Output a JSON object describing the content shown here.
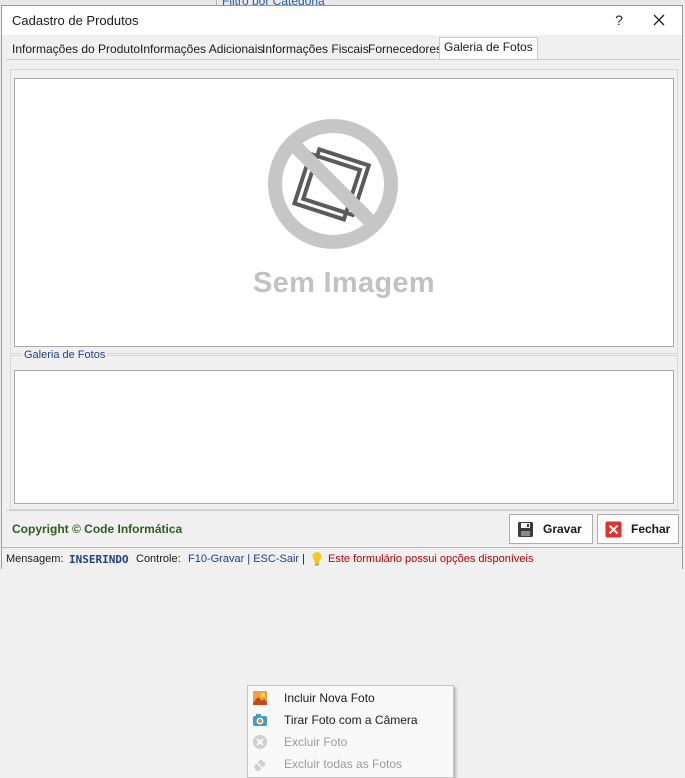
{
  "background": {
    "filter_label": "Filtro por Categoria"
  },
  "window": {
    "title": "Cadastro de Produtos",
    "help_label": "?"
  },
  "tabs": [
    {
      "label": "Informações do Produto"
    },
    {
      "label": "Informações Adicionais"
    },
    {
      "label": "Informações Fiscais"
    },
    {
      "label": "Fornecedores"
    },
    {
      "label": "Galeria de Fotos"
    }
  ],
  "selected_tab": "Galeria de Fotos",
  "image_panel": {
    "placeholder_text": "Sem Imagem"
  },
  "gallery": {
    "group_label": "Galeria de Fotos",
    "context_menu": [
      {
        "label": "Incluir Nova Foto",
        "icon": "photo-add-icon",
        "enabled": true
      },
      {
        "label": "Tirar Foto com a Câmera",
        "icon": "camera-icon",
        "enabled": true
      },
      {
        "label": "Excluir Foto",
        "icon": "delete-circle-icon",
        "enabled": false
      },
      {
        "label": "Excluir todas as Fotos",
        "icon": "eraser-icon",
        "enabled": false
      }
    ]
  },
  "footer": {
    "copyright": "Copyright © Code Informática",
    "save_label": "Gravar",
    "close_label": "Fechar"
  },
  "status": {
    "message_label": "Mensagem:",
    "message_value": "INSERINDO",
    "control_label": "Controle:",
    "control_value": "F10-Gravar | ESC-Sair",
    "separator": "|",
    "hint": "Este formulário possui opções disponíveis"
  },
  "colors": {
    "accent_blue": "#1f3f8f",
    "copyright_green": "#2e5e1e",
    "hint_red": "#c00000",
    "close_red": "#e0302f"
  }
}
